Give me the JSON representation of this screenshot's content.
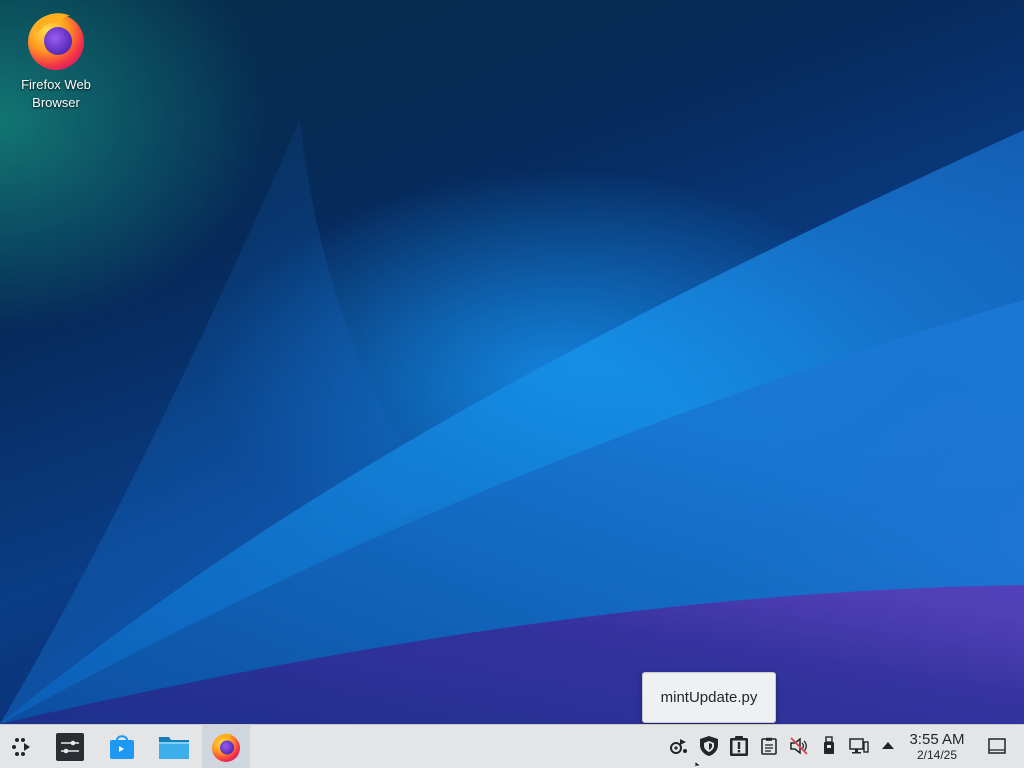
{
  "desktop": {
    "icons": [
      {
        "label": "Firefox Web Browser",
        "icon": "firefox-icon"
      }
    ]
  },
  "tooltip": {
    "text": "mintUpdate.py"
  },
  "taskbar": {
    "launcher": {
      "icon": "application-launcher-icon"
    },
    "pinned": [
      {
        "name": "system-settings",
        "icon": "settings-sliders-icon"
      },
      {
        "name": "discover-store",
        "icon": "store-bag-icon"
      },
      {
        "name": "file-manager",
        "icon": "folder-icon"
      },
      {
        "name": "firefox",
        "icon": "firefox-icon",
        "active": true
      }
    ],
    "tray": [
      {
        "name": "update-manager",
        "icon": "update-icon"
      },
      {
        "name": "security",
        "icon": "shield-icon"
      },
      {
        "name": "notifications",
        "icon": "alert-clipboard-icon"
      },
      {
        "name": "clipboard",
        "icon": "clipboard-icon"
      },
      {
        "name": "volume",
        "icon": "muted-speaker-icon"
      },
      {
        "name": "usb-devices",
        "icon": "usb-drive-icon"
      },
      {
        "name": "network",
        "icon": "network-wired-icon"
      },
      {
        "name": "expand-tray",
        "icon": "arrow-up-icon"
      }
    ],
    "clock": {
      "time": "3:55 AM",
      "date": "2/14/25"
    },
    "show_desktop": {
      "icon": "show-desktop-icon"
    }
  }
}
